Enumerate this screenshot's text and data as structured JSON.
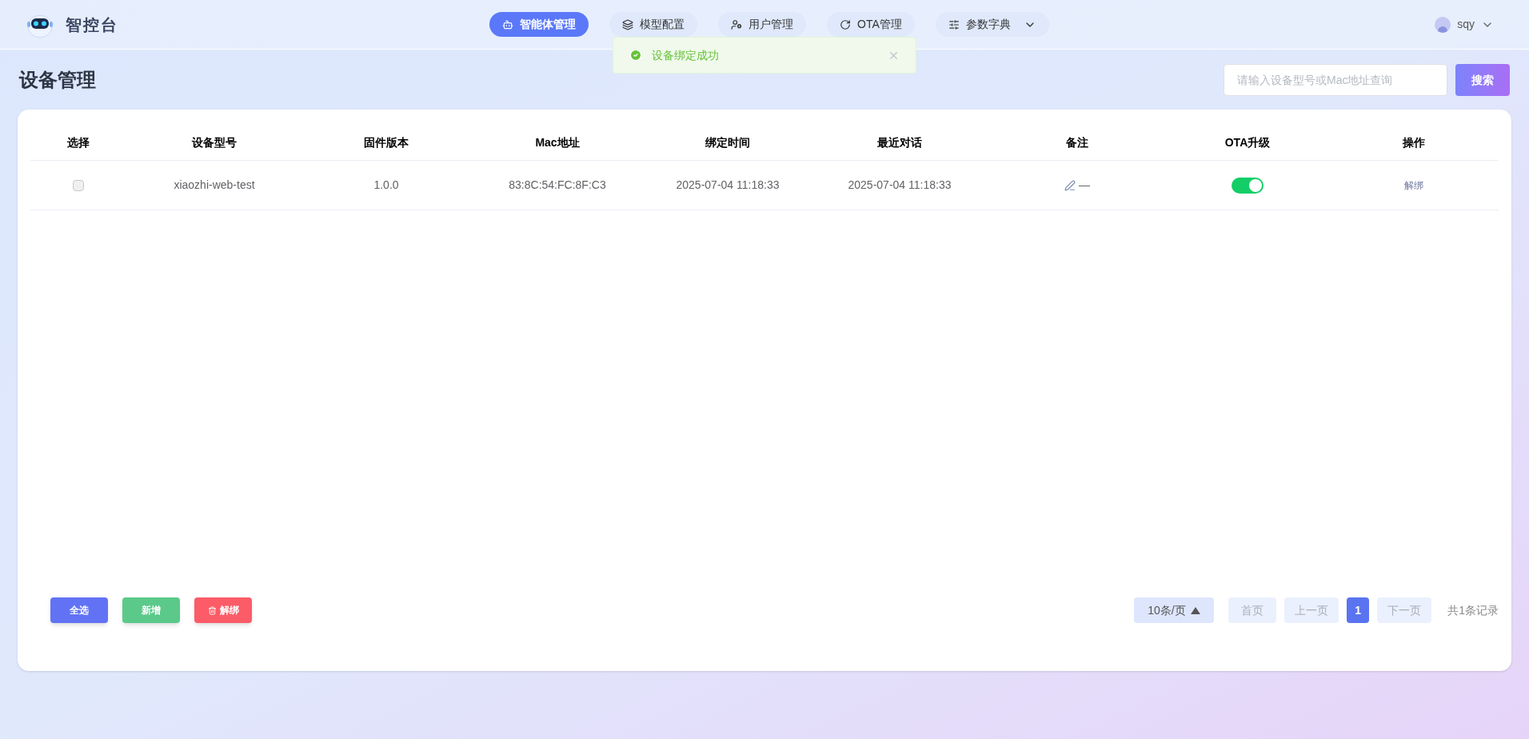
{
  "brand": {
    "name": "智控台"
  },
  "nav": [
    {
      "label": "智能体管理",
      "kind": "agents",
      "selected": true,
      "dropdown": false
    },
    {
      "label": "模型配置",
      "kind": "models",
      "selected": false,
      "dropdown": false
    },
    {
      "label": "用户管理",
      "kind": "users",
      "selected": false,
      "dropdown": false
    },
    {
      "label": "OTA管理",
      "kind": "ota",
      "selected": false,
      "dropdown": false
    },
    {
      "label": "参数字典",
      "kind": "params",
      "selected": false,
      "dropdown": true
    }
  ],
  "user": {
    "name": "sqy"
  },
  "toast": {
    "message": "设备绑定成功"
  },
  "page": {
    "title": "设备管理"
  },
  "search": {
    "placeholder": "请输入设备型号或Mac地址查询",
    "button": "搜索"
  },
  "table": {
    "columns": [
      "选择",
      "设备型号",
      "固件版本",
      "Mac地址",
      "绑定时间",
      "最近对话",
      "备注",
      "OTA升级",
      "操作"
    ],
    "rows": [
      {
        "checked": false,
        "model": "xiaozhi-web-test",
        "firmware": "1.0.0",
        "mac": "83:8C:54:FC:8F:C3",
        "bind_time": "2025-07-04 11:18:33",
        "last_chat": "2025-07-04 11:18:33",
        "note": "—",
        "ota_on": true,
        "action": "解绑"
      }
    ]
  },
  "actions": [
    {
      "label": "全选",
      "kind": "select"
    },
    {
      "label": "新增",
      "kind": "add"
    },
    {
      "label": "解绑",
      "kind": "delete"
    }
  ],
  "pagination": {
    "page_size": "10条/页",
    "first": "首页",
    "prev": "上一页",
    "pages": [
      {
        "label": "1",
        "selected": true
      }
    ],
    "next": "下一页",
    "total": "共1条记录"
  }
}
